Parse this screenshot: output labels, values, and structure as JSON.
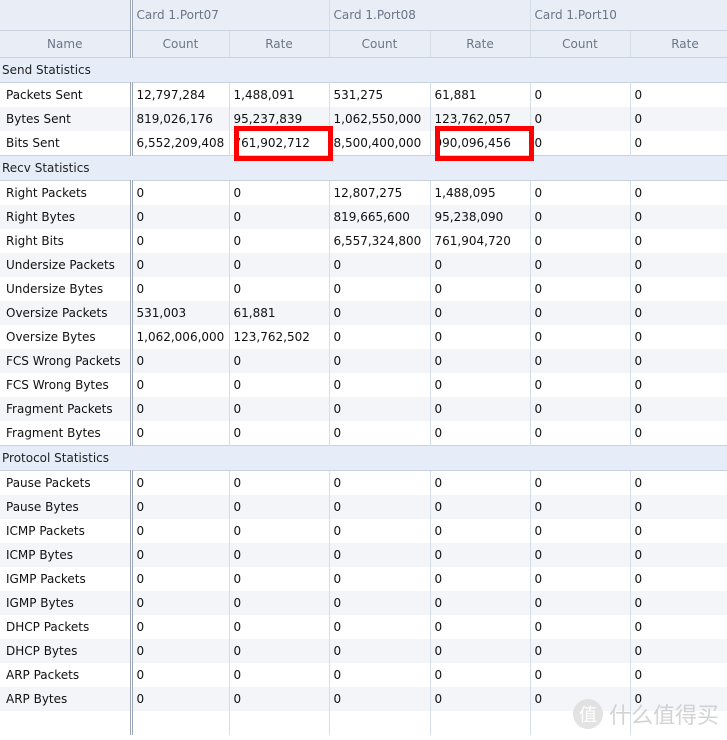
{
  "header": {
    "name_label": "Name",
    "ports": [
      {
        "title": "Card 1.Port07",
        "count_label": "Count",
        "rate_label": "Rate"
      },
      {
        "title": "Card 1.Port08",
        "count_label": "Count",
        "rate_label": "Rate"
      },
      {
        "title": "Card 1.Port10",
        "count_label": "Count",
        "rate_label": "Rate"
      }
    ]
  },
  "sections": [
    {
      "title": "Send Statistics",
      "rows": [
        {
          "name": "Packets Sent",
          "values": [
            "12,797,284",
            "1,488,091",
            "531,275",
            "61,881",
            "0",
            "0"
          ]
        },
        {
          "name": "Bytes Sent",
          "values": [
            "819,026,176",
            "95,237,839",
            "1,062,550,000",
            "123,762,057",
            "0",
            "0"
          ]
        },
        {
          "name": "Bits Sent",
          "values": [
            "6,552,209,408",
            "761,902,712",
            "8,500,400,000",
            "990,096,456",
            "0",
            "0"
          ],
          "highlight": [
            1,
            3
          ]
        }
      ]
    },
    {
      "title": "Recv Statistics",
      "rows": [
        {
          "name": "Right Packets",
          "values": [
            "0",
            "0",
            "12,807,275",
            "1,488,095",
            "0",
            "0"
          ]
        },
        {
          "name": "Right Bytes",
          "values": [
            "0",
            "0",
            "819,665,600",
            "95,238,090",
            "0",
            "0"
          ]
        },
        {
          "name": "Right Bits",
          "values": [
            "0",
            "0",
            "6,557,324,800",
            "761,904,720",
            "0",
            "0"
          ]
        },
        {
          "name": "Undersize Packets",
          "values": [
            "0",
            "0",
            "0",
            "0",
            "0",
            "0"
          ]
        },
        {
          "name": "Undersize Bytes",
          "values": [
            "0",
            "0",
            "0",
            "0",
            "0",
            "0"
          ]
        },
        {
          "name": "Oversize Packets",
          "values": [
            "531,003",
            "61,881",
            "0",
            "0",
            "0",
            "0"
          ]
        },
        {
          "name": "Oversize Bytes",
          "values": [
            "1,062,006,000",
            "123,762,502",
            "0",
            "0",
            "0",
            "0"
          ]
        },
        {
          "name": "FCS Wrong Packets",
          "values": [
            "0",
            "0",
            "0",
            "0",
            "0",
            "0"
          ]
        },
        {
          "name": "FCS Wrong Bytes",
          "values": [
            "0",
            "0",
            "0",
            "0",
            "0",
            "0"
          ]
        },
        {
          "name": "Fragment Packets",
          "values": [
            "0",
            "0",
            "0",
            "0",
            "0",
            "0"
          ]
        },
        {
          "name": "Fragment Bytes",
          "values": [
            "0",
            "0",
            "0",
            "0",
            "0",
            "0"
          ]
        }
      ]
    },
    {
      "title": "Protocol Statistics",
      "rows": [
        {
          "name": "Pause Packets",
          "values": [
            "0",
            "0",
            "0",
            "0",
            "0",
            "0"
          ]
        },
        {
          "name": "Pause Bytes",
          "values": [
            "0",
            "0",
            "0",
            "0",
            "0",
            "0"
          ]
        },
        {
          "name": "ICMP Packets",
          "values": [
            "0",
            "0",
            "0",
            "0",
            "0",
            "0"
          ]
        },
        {
          "name": "ICMP Bytes",
          "values": [
            "0",
            "0",
            "0",
            "0",
            "0",
            "0"
          ]
        },
        {
          "name": "IGMP Packets",
          "values": [
            "0",
            "0",
            "0",
            "0",
            "0",
            "0"
          ]
        },
        {
          "name": "IGMP Bytes",
          "values": [
            "0",
            "0",
            "0",
            "0",
            "0",
            "0"
          ]
        },
        {
          "name": "DHCP Packets",
          "values": [
            "0",
            "0",
            "0",
            "0",
            "0",
            "0"
          ]
        },
        {
          "name": "DHCP Bytes",
          "values": [
            "0",
            "0",
            "0",
            "0",
            "0",
            "0"
          ]
        },
        {
          "name": "ARP Packets",
          "values": [
            "0",
            "0",
            "0",
            "0",
            "0",
            "0"
          ]
        },
        {
          "name": "ARP Bytes",
          "values": [
            "0",
            "0",
            "0",
            "0",
            "0",
            "0"
          ]
        },
        {
          "name": "",
          "values": [
            "",
            "",
            "",
            "",
            "",
            ""
          ]
        }
      ]
    }
  ],
  "highlight_color": "#ff0000",
  "watermark": {
    "icon": "值",
    "text": "什么值得买"
  }
}
